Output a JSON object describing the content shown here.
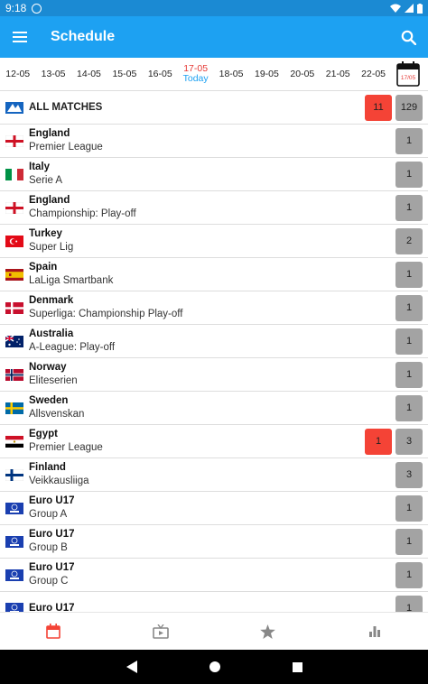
{
  "status_bar": {
    "time": "9:18"
  },
  "app_bar": {
    "title": "Schedule"
  },
  "dates": [
    {
      "label": "12-05"
    },
    {
      "label": "13-05"
    },
    {
      "label": "14-05"
    },
    {
      "label": "15-05"
    },
    {
      "label": "16-05"
    },
    {
      "label": "17-05",
      "sub": "Today",
      "active": true
    },
    {
      "label": "18-05"
    },
    {
      "label": "19-05"
    },
    {
      "label": "20-05"
    },
    {
      "label": "21-05"
    },
    {
      "label": "22-05"
    }
  ],
  "calendar_button": {
    "date": "17/05"
  },
  "all_matches": {
    "label": "ALL MATCHES",
    "live_count": "11",
    "total_count": "129"
  },
  "leagues": [
    {
      "country": "England",
      "league": "Premier League",
      "flag": "england",
      "count": "1"
    },
    {
      "country": "Italy",
      "league": "Serie A",
      "flag": "italy",
      "count": "1"
    },
    {
      "country": "England",
      "league": "Championship: Play-off",
      "flag": "england",
      "count": "1"
    },
    {
      "country": "Turkey",
      "league": "Super Lig",
      "flag": "turkey",
      "count": "2"
    },
    {
      "country": "Spain",
      "league": "LaLiga Smartbank",
      "flag": "spain",
      "count": "1"
    },
    {
      "country": "Denmark",
      "league": "Superliga: Championship Play-off",
      "flag": "denmark",
      "count": "1"
    },
    {
      "country": "Australia",
      "league": "A-League: Play-off",
      "flag": "australia",
      "count": "1"
    },
    {
      "country": "Norway",
      "league": "Eliteserien",
      "flag": "norway",
      "count": "1"
    },
    {
      "country": "Sweden",
      "league": "Allsvenskan",
      "flag": "sweden",
      "count": "1"
    },
    {
      "country": "Egypt",
      "league": "Premier League",
      "flag": "egypt",
      "live": "1",
      "count": "3"
    },
    {
      "country": "Finland",
      "league": "Veikkausliiga",
      "flag": "finland",
      "count": "3"
    },
    {
      "country": "Euro U17",
      "league": "Group A",
      "flag": "uefa",
      "count": "1"
    },
    {
      "country": "Euro U17",
      "league": "Group B",
      "flag": "uefa",
      "count": "1"
    },
    {
      "country": "Euro U17",
      "league": "Group C",
      "flag": "uefa",
      "count": "1"
    },
    {
      "country": "Euro U17",
      "league": "",
      "flag": "uefa",
      "count": "1"
    }
  ],
  "bottom_nav": [
    {
      "name": "schedule",
      "icon": "calendar-icon",
      "active": true
    },
    {
      "name": "live-tv",
      "icon": "tv-icon"
    },
    {
      "name": "favorites",
      "icon": "star-icon"
    },
    {
      "name": "standings",
      "icon": "bar-chart-icon"
    }
  ],
  "colors": {
    "primary": "#1da1f2",
    "live": "#f44336",
    "count_badge": "#a3a3a3",
    "active_nav": "#f44336"
  }
}
